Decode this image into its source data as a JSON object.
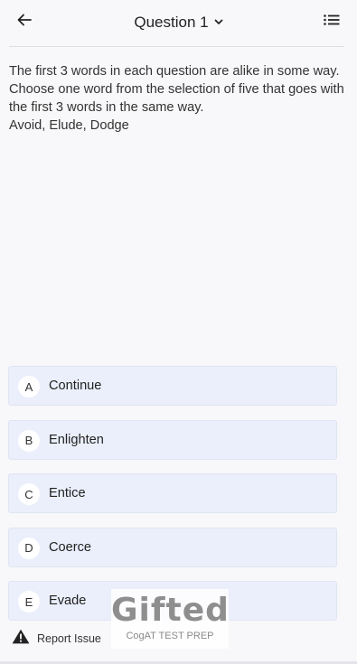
{
  "header": {
    "title": "Question 1",
    "back_icon": "arrow-left-icon",
    "dropdown_icon": "chevron-down-icon",
    "list_icon": "list-icon"
  },
  "question": {
    "prompt": "The first 3 words in each question are alike in some way. Choose one word from the selection of five that goes with the first 3 words in the same way.",
    "words": "Avoid, Elude, Dodge"
  },
  "options": [
    {
      "letter": "A",
      "label": "Continue"
    },
    {
      "letter": "B",
      "label": "Enlighten"
    },
    {
      "letter": "C",
      "label": "Entice"
    },
    {
      "letter": "D",
      "label": "Coerce"
    },
    {
      "letter": "E",
      "label": "Evade"
    }
  ],
  "footer": {
    "report_label": "Report Issue",
    "report_icon": "warning-icon"
  },
  "watermark": {
    "brand": "Gifted",
    "tagline": "CogAT TEST PREP"
  },
  "colors": {
    "option_bg": "#ebeffb",
    "background": "#f8f8fa"
  }
}
